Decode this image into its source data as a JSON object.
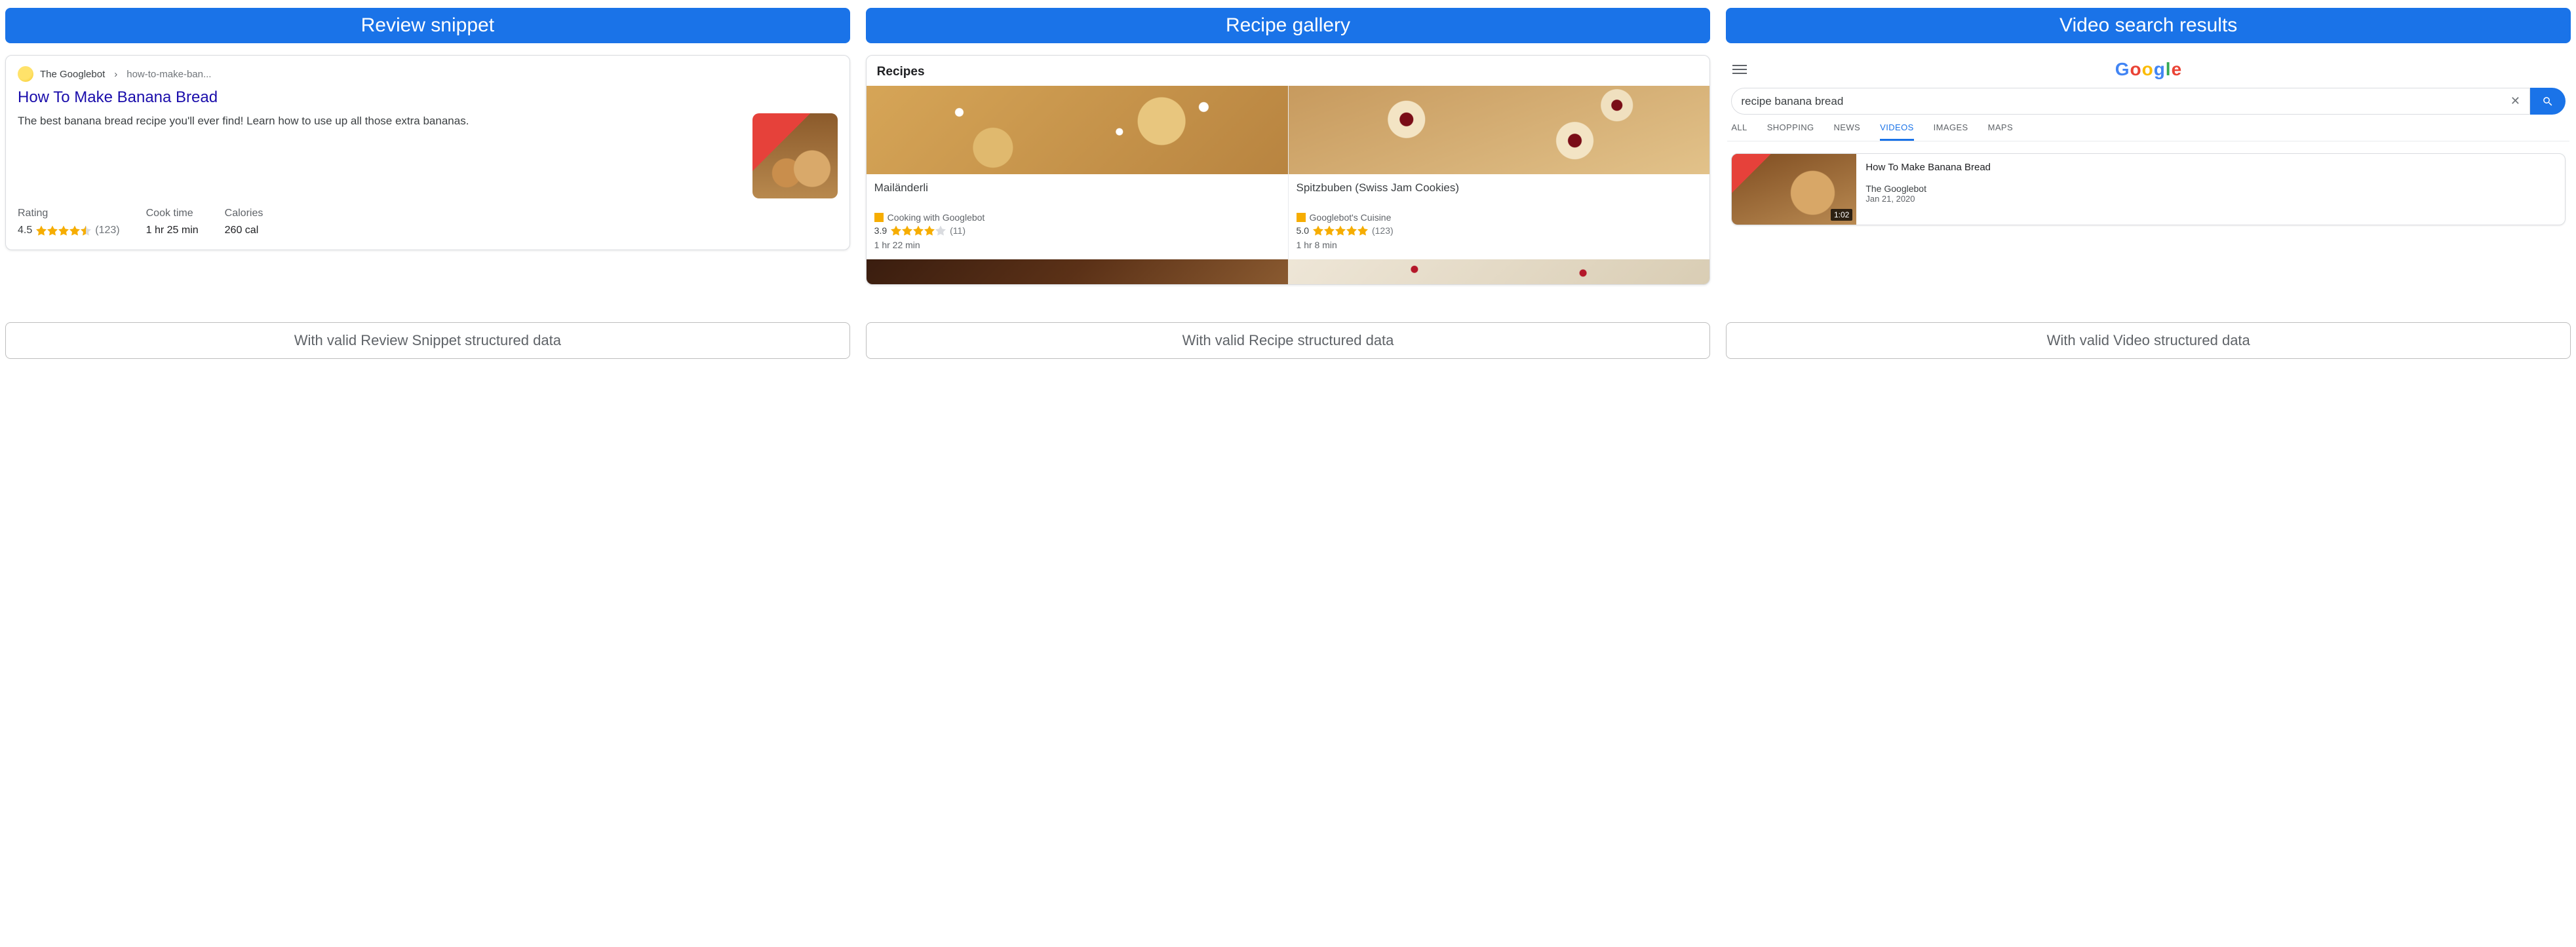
{
  "columns": {
    "review": {
      "header": "Review snippet",
      "footer": "With valid Review Snippet structured data",
      "source_name": "The Googlebot",
      "source_path": "how-to-make-ban...",
      "title": "How To Make Banana Bread",
      "description": "The best banana bread recipe you'll ever find! Learn how to use up all those extra bananas.",
      "stats": {
        "rating_label": "Rating",
        "rating_value": "4.5",
        "rating_count": "(123)",
        "cook_label": "Cook time",
        "cook_value": "1 hr 25 min",
        "calories_label": "Calories",
        "calories_value": "260 cal"
      }
    },
    "recipe": {
      "header": "Recipe gallery",
      "footer": "With valid Recipe structured data",
      "block_title": "Recipes",
      "items": [
        {
          "name": "Mailänderli",
          "source": "Cooking with Googlebot",
          "rating": "3.9",
          "count": "(11)",
          "time": "1 hr 22 min"
        },
        {
          "name": "Spitzbuben (Swiss Jam Cookies)",
          "source": "Googlebot's Cuisine",
          "rating": "5.0",
          "count": "(123)",
          "time": "1 hr 8 min"
        }
      ]
    },
    "video": {
      "header": "Video search results",
      "footer": "With valid Video structured data",
      "logo_letters": [
        "G",
        "o",
        "o",
        "g",
        "l",
        "e"
      ],
      "query": "recipe banana bread",
      "tabs": [
        "ALL",
        "SHOPPING",
        "NEWS",
        "VIDEOS",
        "IMAGES",
        "MAPS"
      ],
      "active_tab": "VIDEOS",
      "result": {
        "title": "How To Make Banana Bread",
        "source": "The Googlebot",
        "date": "Jan 21, 2020",
        "duration": "1:02"
      }
    }
  }
}
